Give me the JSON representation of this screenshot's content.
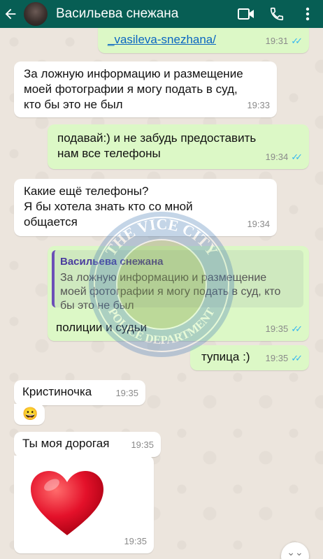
{
  "header": {
    "contact_name": "Васильева снежана"
  },
  "messages": [
    {
      "text": "_vasileva-snezhana/",
      "time": "19:31"
    },
    {
      "text": "За ложную информацию и размещение\nмоей фотографии я могу подать в суд,\nкто бы это не был",
      "time": "19:33"
    },
    {
      "text": "подавай:) и не забудь предоставить\nнам все телефоны",
      "time": "19:34"
    },
    {
      "text": "Какие ещё телефоны?\nЯ бы хотела знать кто со мной\nобщается",
      "time": "19:34"
    },
    {
      "quote_author": "Васильева снежана",
      "quote_text": "За ложную информацию и размещение\nмоей фотографии я могу подать в суд, кто\nбы это не был",
      "text": "полиции и судьи",
      "time": "19:35"
    },
    {
      "text": "тупица :)",
      "time": "19:35"
    },
    {
      "text": "Кристиночка",
      "time": "19:35"
    },
    {
      "text": "😀"
    },
    {
      "text": "Ты моя дорогая",
      "time": "19:35"
    },
    {
      "text": "❤",
      "time": "19:35"
    }
  ],
  "watermark": {
    "top_text": "THE VICE CITY",
    "bottom_text": "POLICE DEPARTMENT"
  },
  "colors": {
    "header": "#075e54",
    "incoming": "#ffffff",
    "outgoing": "#dcf8c6",
    "read_ticks": "#34b7f1"
  },
  "icons": [
    "back-arrow-icon",
    "video-call-icon",
    "phone-icon",
    "more-vert-icon",
    "double-check-icon",
    "scroll-down-icon"
  ]
}
